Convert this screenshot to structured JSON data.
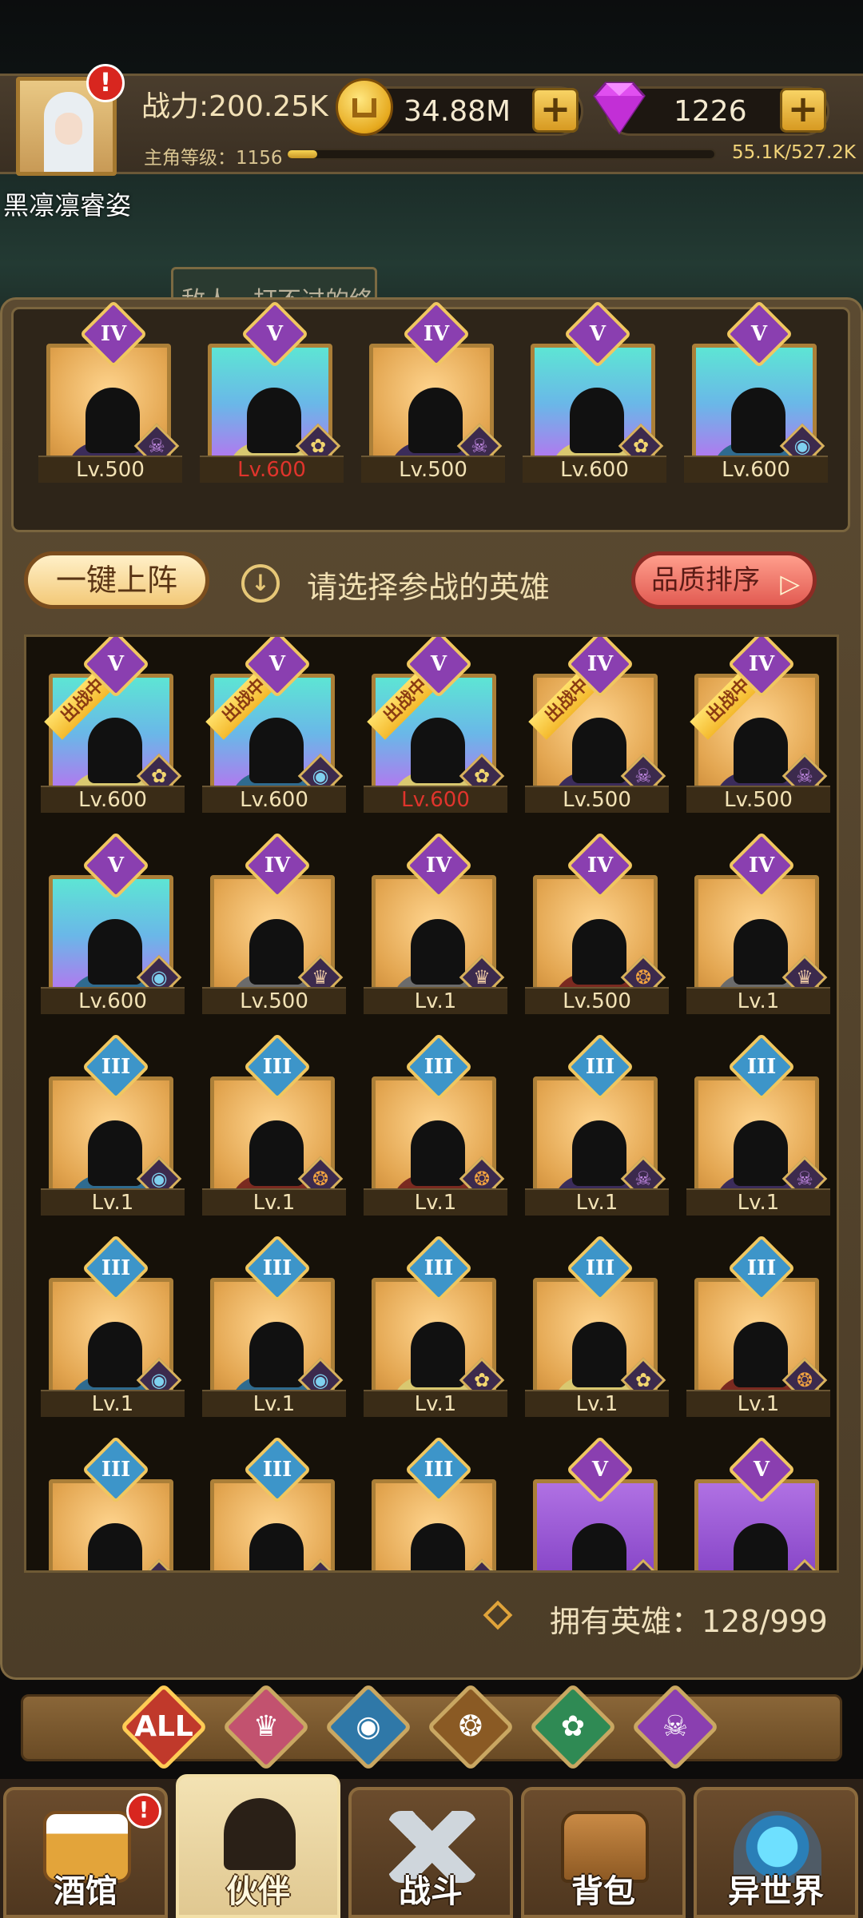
{
  "player": {
    "power": "战力:200.25K",
    "name": "黑凛凛睿姿",
    "level_label": "主角等级：1156",
    "level_progress": 0.07,
    "exp": "55.1K/527.2K",
    "alert": "!"
  },
  "currency": {
    "coins": "34.88M",
    "gems": "1226",
    "plus": "+"
  },
  "hint": "敌人，打不过的终",
  "team": [
    {
      "rank": "IV",
      "level": "Lv.500",
      "bg": "gold",
      "faction": "demon",
      "red": false
    },
    {
      "rank": "V",
      "level": "Lv.600",
      "bg": "cyan",
      "faction": "elf",
      "red": true
    },
    {
      "rank": "IV",
      "level": "Lv.500",
      "bg": "gold",
      "faction": "demon",
      "red": false
    },
    {
      "rank": "V",
      "level": "Lv.600",
      "bg": "cyan",
      "faction": "elf",
      "red": false
    },
    {
      "rank": "V",
      "level": "Lv.600",
      "bg": "cyan",
      "faction": "sea",
      "red": false
    }
  ],
  "actions": {
    "auto_deploy": "一键上阵",
    "select_hint": "请选择参战的英雄",
    "sort": "品质排序",
    "sort_arrow": "▷",
    "down_arrow": "↓"
  },
  "deployed_label": "出战中",
  "heroes": [
    {
      "rank": "V",
      "level": "Lv.600",
      "bg": "cyan",
      "faction": "elf",
      "deployed": true,
      "red": false
    },
    {
      "rank": "V",
      "level": "Lv.600",
      "bg": "cyan",
      "faction": "sea",
      "deployed": true,
      "red": false
    },
    {
      "rank": "V",
      "level": "Lv.600",
      "bg": "cyan",
      "faction": "elf",
      "deployed": true,
      "red": true
    },
    {
      "rank": "IV",
      "level": "Lv.500",
      "bg": "gold",
      "faction": "demon",
      "deployed": true,
      "red": false
    },
    {
      "rank": "IV",
      "level": "Lv.500",
      "bg": "gold",
      "faction": "demon",
      "deployed": true,
      "red": false
    },
    {
      "rank": "V",
      "level": "Lv.600",
      "bg": "cyan",
      "faction": "sea",
      "deployed": false,
      "red": false
    },
    {
      "rank": "IV",
      "level": "Lv.500",
      "bg": "gold",
      "faction": "human",
      "deployed": false,
      "red": false
    },
    {
      "rank": "IV",
      "level": "Lv.1",
      "bg": "gold",
      "faction": "human",
      "deployed": false,
      "red": false
    },
    {
      "rank": "IV",
      "level": "Lv.500",
      "bg": "gold",
      "faction": "beast",
      "deployed": false,
      "red": false
    },
    {
      "rank": "IV",
      "level": "Lv.1",
      "bg": "gold",
      "faction": "human",
      "deployed": false,
      "red": false
    },
    {
      "rank": "III",
      "level": "Lv.1",
      "bg": "gold",
      "faction": "sea",
      "deployed": false,
      "red": false
    },
    {
      "rank": "III",
      "level": "Lv.1",
      "bg": "gold",
      "faction": "beast",
      "deployed": false,
      "red": false
    },
    {
      "rank": "III",
      "level": "Lv.1",
      "bg": "gold",
      "faction": "beast",
      "deployed": false,
      "red": false
    },
    {
      "rank": "III",
      "level": "Lv.1",
      "bg": "gold",
      "faction": "demon",
      "deployed": false,
      "red": false
    },
    {
      "rank": "III",
      "level": "Lv.1",
      "bg": "gold",
      "faction": "demon",
      "deployed": false,
      "red": false
    },
    {
      "rank": "III",
      "level": "Lv.1",
      "bg": "gold",
      "faction": "sea",
      "deployed": false,
      "red": false
    },
    {
      "rank": "III",
      "level": "Lv.1",
      "bg": "gold",
      "faction": "sea",
      "deployed": false,
      "red": false
    },
    {
      "rank": "III",
      "level": "Lv.1",
      "bg": "gold",
      "faction": "elf",
      "deployed": false,
      "red": false
    },
    {
      "rank": "III",
      "level": "Lv.1",
      "bg": "gold",
      "faction": "elf",
      "deployed": false,
      "red": false
    },
    {
      "rank": "III",
      "level": "Lv.1",
      "bg": "gold",
      "faction": "beast",
      "deployed": false,
      "red": false
    },
    {
      "rank": "III",
      "level": "",
      "bg": "gold",
      "faction": "human",
      "deployed": false,
      "red": false
    },
    {
      "rank": "III",
      "level": "",
      "bg": "gold",
      "faction": "human",
      "deployed": false,
      "red": false
    },
    {
      "rank": "III",
      "level": "",
      "bg": "gold",
      "faction": "human",
      "deployed": false,
      "red": false
    },
    {
      "rank": "V",
      "level": "",
      "bg": "purple",
      "faction": "demon",
      "deployed": false,
      "red": false
    },
    {
      "rank": "V",
      "level": "",
      "bg": "purple",
      "faction": "elf",
      "deployed": false,
      "red": false
    }
  ],
  "owned": "拥有英雄：128/999",
  "filters": [
    {
      "label": "ALL",
      "icon": "all-icon",
      "color": "#c0392b"
    },
    {
      "label": "",
      "icon": "human-faction-icon",
      "color": "#c2526f"
    },
    {
      "label": "",
      "icon": "sea-faction-icon",
      "color": "#2f78a8"
    },
    {
      "label": "",
      "icon": "beast-faction-icon",
      "color": "#8a5a24"
    },
    {
      "label": "",
      "icon": "elf-faction-icon",
      "color": "#2f8a54"
    },
    {
      "label": "",
      "icon": "demon-faction-icon",
      "color": "#8a3fb0"
    }
  ],
  "nav": [
    {
      "label": "酒馆",
      "icon": "tavern-icon",
      "alert": true,
      "active": false
    },
    {
      "label": "伙伴",
      "icon": "partner-icon",
      "alert": false,
      "active": true
    },
    {
      "label": "战斗",
      "icon": "battle-icon",
      "alert": false,
      "active": false
    },
    {
      "label": "背包",
      "icon": "backpack-icon",
      "alert": false,
      "active": false
    },
    {
      "label": "异世界",
      "icon": "otherworld-icon",
      "alert": false,
      "active": false
    }
  ],
  "colors": {
    "rank_III": "#3d95c9",
    "rank_IV": "#8a3fb0",
    "rank_V": "#8a3fb0",
    "level_red": "#e0342c"
  }
}
